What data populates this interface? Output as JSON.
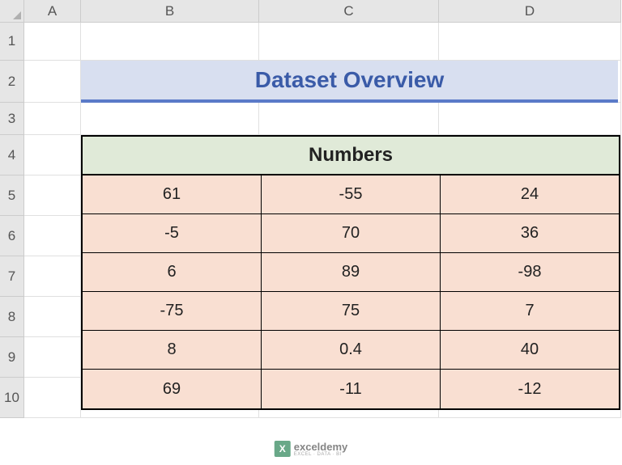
{
  "columns": [
    "A",
    "B",
    "C",
    "D"
  ],
  "rows": [
    "1",
    "2",
    "3",
    "4",
    "5",
    "6",
    "7",
    "8",
    "9",
    "10"
  ],
  "title": "Dataset Overview",
  "table_header": "Numbers",
  "chart_data": {
    "type": "table",
    "title": "Numbers",
    "columns": [
      "B",
      "C",
      "D"
    ],
    "rows": [
      [
        61,
        -55,
        24
      ],
      [
        -5,
        70,
        36
      ],
      [
        6,
        89,
        -98
      ],
      [
        -75,
        75,
        7
      ],
      [
        8,
        0.4,
        40
      ],
      [
        69,
        -11,
        -12
      ]
    ]
  },
  "watermark": {
    "icon_letter": "X",
    "main": "exceldemy",
    "sub": "EXCEL · DATA · BI"
  }
}
